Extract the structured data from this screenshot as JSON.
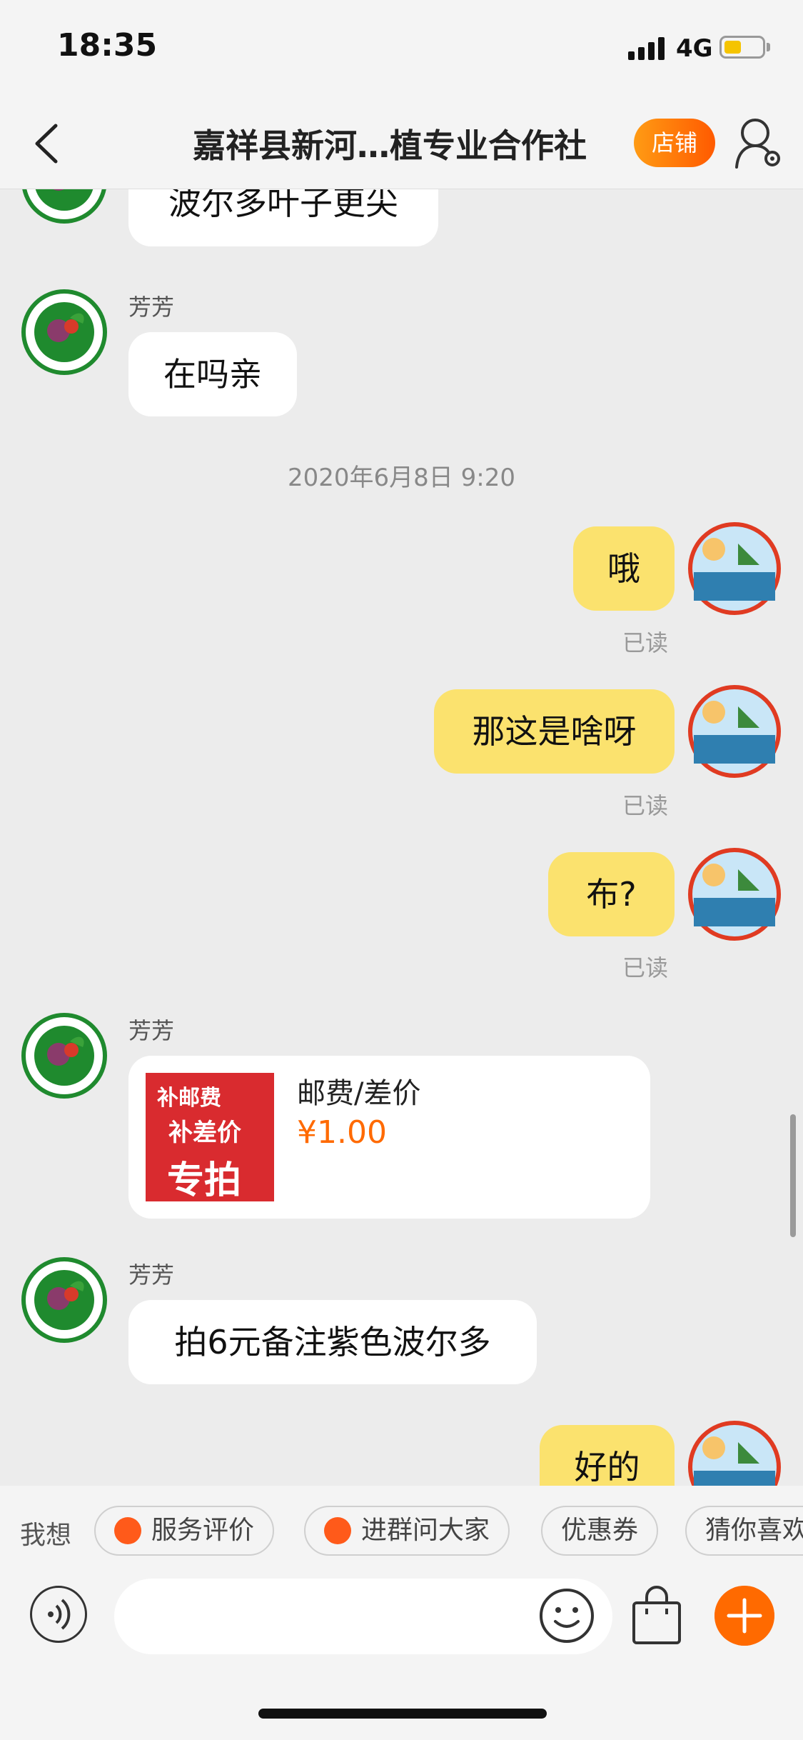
{
  "status": {
    "time": "18:35",
    "network": "4G",
    "battery_level": 0.45
  },
  "header": {
    "title": "嘉祥县新河…植专业合作社",
    "shop_button": "店铺"
  },
  "messages": {
    "m1_text": "波尔多叶子更尖",
    "m2_sender": "芳芳",
    "m2_text": "在吗亲",
    "timestamp": "2020年6月8日 9:20",
    "m3_text": "哦",
    "m4_text": "那这是啥呀",
    "m5_text": "布?",
    "read_label": "已读",
    "m6_sender": "芳芳",
    "card_title": "邮费/差价",
    "card_price": "¥1.00",
    "card_image_text": {
      "line1": "补邮费",
      "line2": "补差价",
      "line3": "专拍"
    },
    "m7_sender": "芳芳",
    "m7_text": "拍6元备注紫色波尔多",
    "m8_text": "好的"
  },
  "quickbar": {
    "label": "我想",
    "items": [
      "服务评价",
      "进群问大家",
      "优惠券",
      "猜你喜欢"
    ]
  },
  "input": {
    "placeholder": ""
  },
  "colors": {
    "accent": "#ff6a00",
    "bubble_self": "#fbe26e",
    "bubble_other": "#ffffff",
    "background": "#ececec"
  }
}
